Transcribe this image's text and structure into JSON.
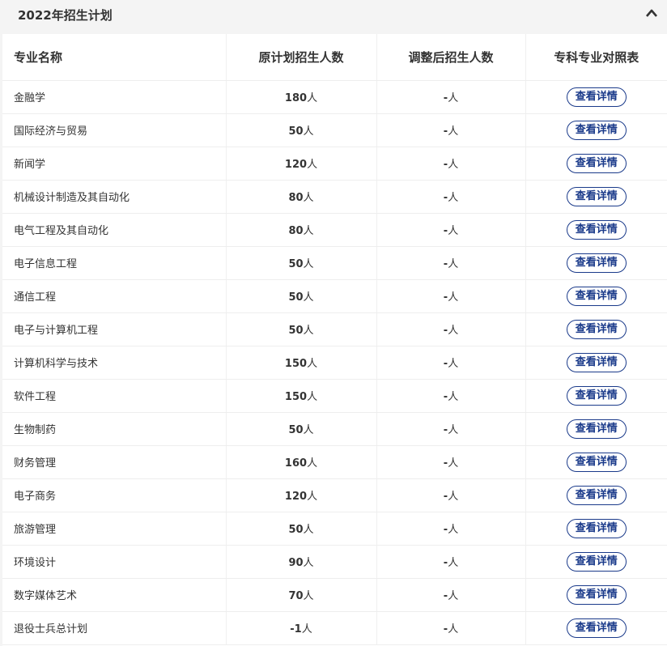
{
  "panel": {
    "title": "2022年招生计划"
  },
  "table": {
    "headers": {
      "name": "专业名称",
      "plan": "原计划招生人数",
      "adjusted": "调整后招生人数",
      "compare": "专科专业对照表"
    },
    "unit": "人",
    "button_label": "查看详情",
    "rows": [
      {
        "name": "金融学",
        "plan": "180",
        "adjusted": "-"
      },
      {
        "name": "国际经济与贸易",
        "plan": "50",
        "adjusted": "-"
      },
      {
        "name": "新闻学",
        "plan": "120",
        "adjusted": "-"
      },
      {
        "name": "机械设计制造及其自动化",
        "plan": "80",
        "adjusted": "-"
      },
      {
        "name": "电气工程及其自动化",
        "plan": "80",
        "adjusted": "-"
      },
      {
        "name": "电子信息工程",
        "plan": "50",
        "adjusted": "-"
      },
      {
        "name": "通信工程",
        "plan": "50",
        "adjusted": "-"
      },
      {
        "name": "电子与计算机工程",
        "plan": "50",
        "adjusted": "-"
      },
      {
        "name": "计算机科学与技术",
        "plan": "150",
        "adjusted": "-"
      },
      {
        "name": "软件工程",
        "plan": "150",
        "adjusted": "-"
      },
      {
        "name": "生物制药",
        "plan": "50",
        "adjusted": "-"
      },
      {
        "name": "财务管理",
        "plan": "160",
        "adjusted": "-"
      },
      {
        "name": "电子商务",
        "plan": "120",
        "adjusted": "-"
      },
      {
        "name": "旅游管理",
        "plan": "50",
        "adjusted": "-"
      },
      {
        "name": "环境设计",
        "plan": "90",
        "adjusted": "-"
      },
      {
        "name": "数字媒体艺术",
        "plan": "70",
        "adjusted": "-"
      },
      {
        "name": "退役士兵总计划",
        "plan": "-1",
        "adjusted": "-"
      }
    ]
  },
  "icons": {
    "collapse": "chevron-up-icon"
  },
  "colors": {
    "button": "#1a3a8a",
    "background": "#f4f4f4"
  }
}
